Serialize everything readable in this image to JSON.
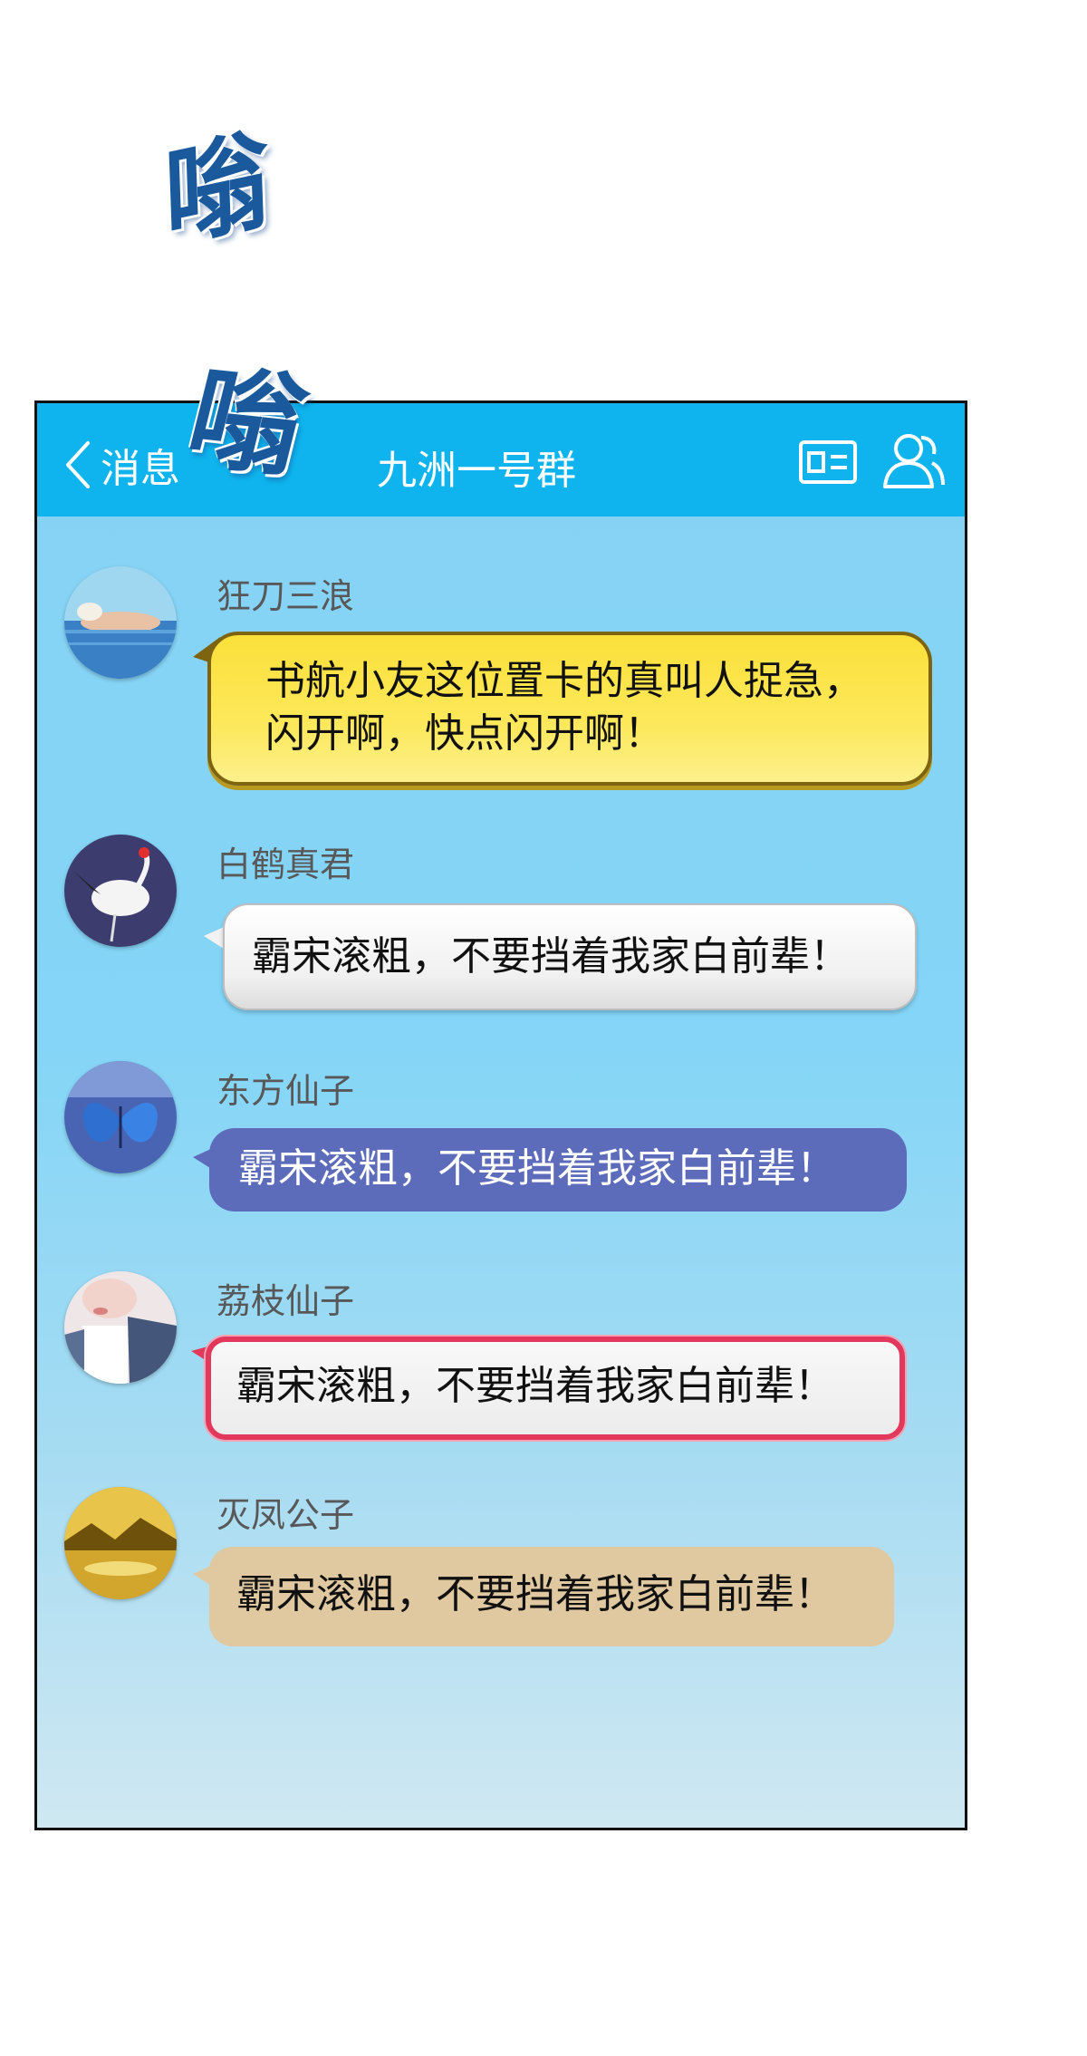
{
  "sfx": [
    "嗡",
    "嗡"
  ],
  "header": {
    "back_label": "消息",
    "title": "九洲一号群"
  },
  "colors": {
    "header": "#0fb4ee",
    "background": "#86d2f4",
    "bubble_yellow": "#fbe03a",
    "bubble_white": "#f0f0f0",
    "bubble_purple": "#5d6cba",
    "bubble_red_border": "#e2385c",
    "bubble_tan": "#e0c9a1"
  },
  "messages": [
    {
      "sender": "狂刀三浪",
      "avatar": "woman-in-water",
      "text": "书航小友这位置卡的真叫人捉急，闪开啊，快点闪开啊！"
    },
    {
      "sender": "白鹤真君",
      "avatar": "white-crane",
      "text": "霸宋滚粗，不要挡着我家白前辈！"
    },
    {
      "sender": "东方仙子",
      "avatar": "blue-butterfly",
      "text": "霸宋滚粗，不要挡着我家白前辈！"
    },
    {
      "sender": "荔枝仙子",
      "avatar": "girl-denim-jacket",
      "text": "霸宋滚粗，不要挡着我家白前辈！"
    },
    {
      "sender": "灭凤公子",
      "avatar": "golden-landscape",
      "text": "霸宋滚粗，不要挡着我家白前辈！"
    }
  ]
}
